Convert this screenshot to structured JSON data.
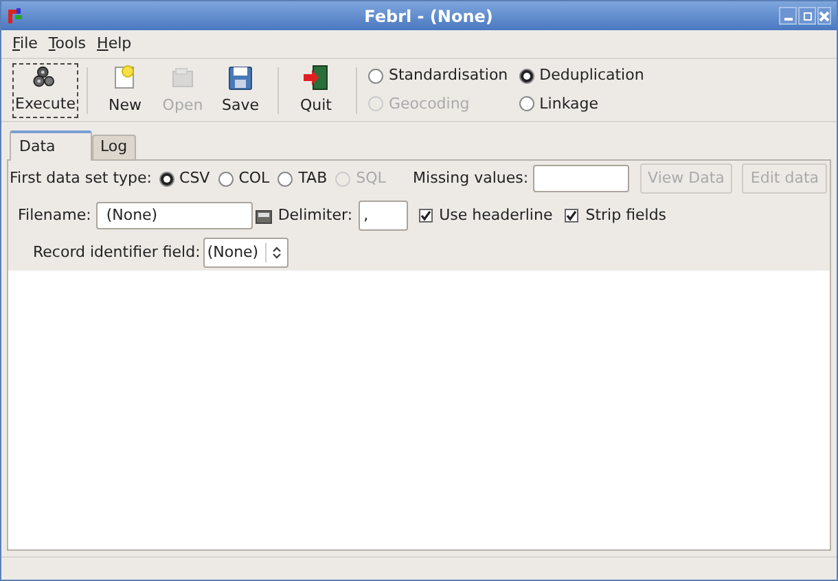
{
  "window": {
    "title": "Febrl - (None)"
  },
  "menu": [
    {
      "label": "File"
    },
    {
      "label": "Tools"
    },
    {
      "label": "Help"
    }
  ],
  "toolbar": [
    {
      "label": "Execute",
      "kind": "execute",
      "disabled": false,
      "focused": true
    },
    {
      "label": "New",
      "kind": "new",
      "disabled": false,
      "focused": false
    },
    {
      "label": "Open",
      "kind": "open",
      "disabled": true,
      "focused": false
    },
    {
      "label": "Save",
      "kind": "save",
      "disabled": false,
      "focused": false
    },
    {
      "label": "Quit",
      "kind": "quit",
      "disabled": false,
      "focused": false
    }
  ],
  "modes": [
    {
      "label": "Standardisation",
      "selected": false,
      "disabled": false
    },
    {
      "label": "Deduplication",
      "selected": true,
      "disabled": false
    },
    {
      "label": "Geocoding",
      "selected": false,
      "disabled": true
    },
    {
      "label": "Linkage",
      "selected": false,
      "disabled": false
    }
  ],
  "tabs": [
    {
      "label": "Data",
      "selected": true
    },
    {
      "label": "Log",
      "selected": false
    }
  ],
  "data_set_type": {
    "label": "First data set type:",
    "options": [
      {
        "label": "CSV",
        "selected": true,
        "disabled": false
      },
      {
        "label": "COL",
        "selected": false,
        "disabled": false
      },
      {
        "label": "TAB",
        "selected": false,
        "disabled": false
      },
      {
        "label": "SQL",
        "selected": false,
        "disabled": true
      }
    ]
  },
  "missing_values": {
    "label": "Missing values:"
  },
  "data_buttons": [
    {
      "label": "View Data",
      "disabled": true
    },
    {
      "label": "Edit data",
      "disabled": true
    }
  ],
  "filename": {
    "label": "Filename:",
    "value": "(None)"
  },
  "delimiter": {
    "label": "Delimiter:",
    "value": ","
  },
  "checkboxes": [
    {
      "label": "Use headerline",
      "checked": true
    },
    {
      "label": "Strip fields",
      "checked": true
    }
  ],
  "record_identifier": {
    "label": "Record identifier field:",
    "value": "(None)"
  }
}
